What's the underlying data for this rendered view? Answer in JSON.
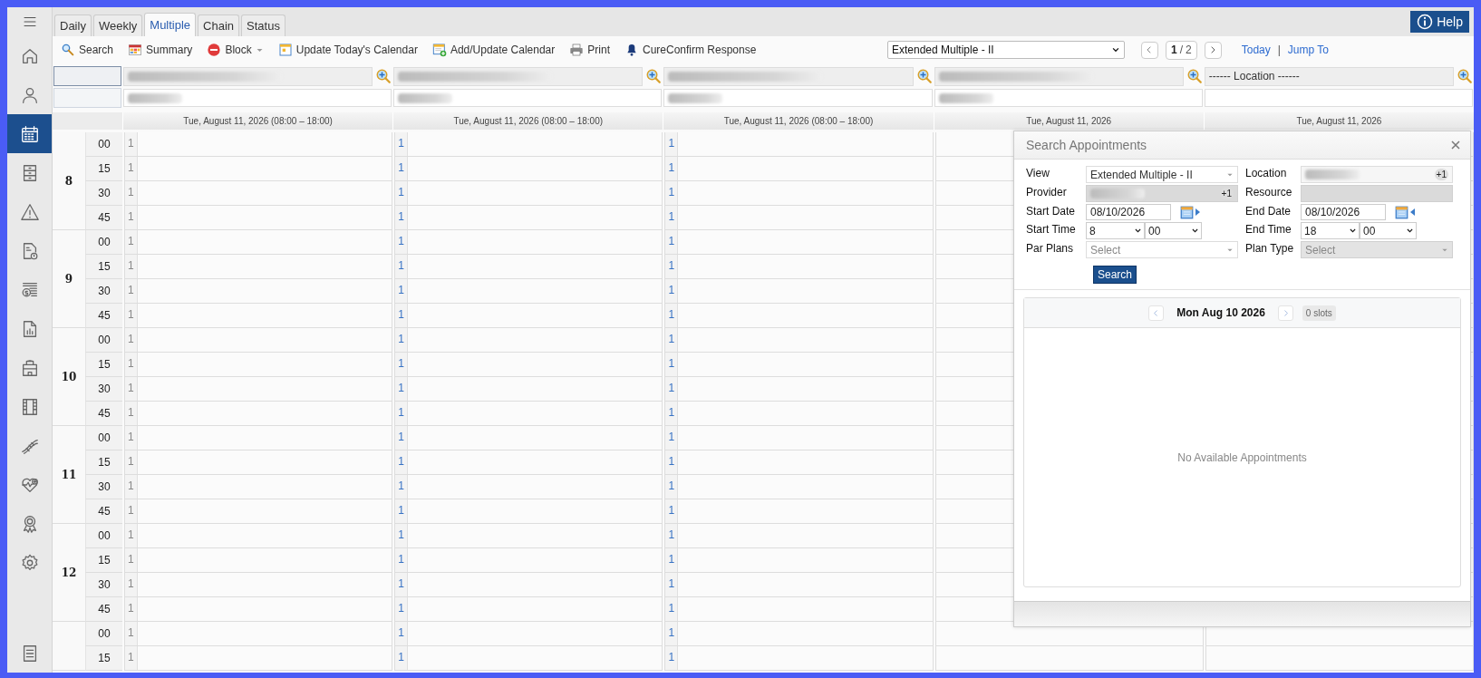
{
  "sidebar": {
    "items": [
      {
        "kind": "home",
        "selected": false
      },
      {
        "kind": "person",
        "selected": false
      },
      {
        "kind": "calendar",
        "selected": true
      },
      {
        "kind": "cabinet",
        "selected": false
      },
      {
        "kind": "warning",
        "selected": false
      },
      {
        "kind": "bill",
        "selected": false
      },
      {
        "kind": "money",
        "selected": false
      },
      {
        "kind": "report",
        "selected": false
      },
      {
        "kind": "building",
        "selected": false
      },
      {
        "kind": "film",
        "selected": false
      },
      {
        "kind": "dna",
        "selected": false
      },
      {
        "kind": "heart",
        "selected": false
      },
      {
        "kind": "award",
        "selected": false
      },
      {
        "kind": "gear",
        "selected": false
      }
    ],
    "bottom": [
      {
        "kind": "list",
        "selected": false
      }
    ]
  },
  "tabs": [
    {
      "label": "Daily",
      "selected": false
    },
    {
      "label": "Weekly",
      "selected": false
    },
    {
      "label": "Multiple",
      "selected": true
    },
    {
      "label": "Chain",
      "selected": false
    },
    {
      "label": "Status",
      "selected": false
    }
  ],
  "help": "Help",
  "toolbar": [
    {
      "kind": "search",
      "label": "Search",
      "dropdown": false
    },
    {
      "kind": "summary",
      "label": "Summary",
      "dropdown": false
    },
    {
      "kind": "block",
      "label": "Block",
      "dropdown": true
    },
    {
      "kind": "today",
      "label": "Update Today's Calendar",
      "dropdown": false
    },
    {
      "kind": "add",
      "label": "Add/Update Calendar",
      "dropdown": false
    },
    {
      "kind": "print",
      "label": "Print",
      "dropdown": false
    },
    {
      "kind": "bell",
      "label": "CureConfirm Response",
      "dropdown": false
    }
  ],
  "view_select": "Extended Multiple - II",
  "pager": {
    "current": "1",
    "separator": "/",
    "total": "2"
  },
  "links": [
    "Today",
    "Jump To"
  ],
  "link_separator": "|",
  "columns": [
    {
      "location_redacted": true,
      "provider_redacted": true,
      "date": "Tue, August 11, 2026 (08:00 – 18:00)",
      "color": "#888888"
    },
    {
      "location_redacted": true,
      "provider_redacted": true,
      "date": "Tue, August 11, 2026 (08:00 – 18:00)",
      "color": "#3772c4"
    },
    {
      "location_redacted": true,
      "provider_redacted": true,
      "date": "Tue, August 11, 2026 (08:00 – 18:00)",
      "color": "#3772c4"
    },
    {
      "location_redacted": true,
      "provider_redacted": true,
      "date": "Tue, August 11, 2026"
    },
    {
      "location": "------ Location ------",
      "provider_redacted": false,
      "date": "Tue, August 11, 2026"
    }
  ],
  "hours": [
    {
      "label": "8",
      "rows": [
        {
          "minute": "00",
          "slots": [
            "1",
            "1",
            "1"
          ]
        },
        {
          "minute": "15",
          "slots": [
            "1",
            "1",
            "1"
          ]
        },
        {
          "minute": "30",
          "slots": [
            "1",
            "1",
            "1"
          ]
        },
        {
          "minute": "45",
          "slots": [
            "1",
            "1",
            "1"
          ]
        }
      ]
    },
    {
      "label": "9",
      "rows": [
        {
          "minute": "00",
          "slots": [
            "1",
            "1",
            "1"
          ]
        },
        {
          "minute": "15",
          "slots": [
            "1",
            "1",
            "1"
          ]
        },
        {
          "minute": "30",
          "slots": [
            "1",
            "1",
            "1"
          ]
        },
        {
          "minute": "45",
          "slots": [
            "1",
            "1",
            "1"
          ]
        }
      ]
    },
    {
      "label": "10",
      "rows": [
        {
          "minute": "00",
          "slots": [
            "1",
            "1",
            "1"
          ]
        },
        {
          "minute": "15",
          "slots": [
            "1",
            "1",
            "1"
          ]
        },
        {
          "minute": "30",
          "slots": [
            "1",
            "1",
            "1"
          ]
        },
        {
          "minute": "45",
          "slots": [
            "1",
            "1",
            "1"
          ]
        }
      ]
    },
    {
      "label": "11",
      "rows": [
        {
          "minute": "00",
          "slots": [
            "1",
            "1",
            "1"
          ]
        },
        {
          "minute": "15",
          "slots": [
            "1",
            "1",
            "1"
          ]
        },
        {
          "minute": "30",
          "slots": [
            "1",
            "1",
            "1"
          ]
        },
        {
          "minute": "45",
          "slots": [
            "1",
            "1",
            "1"
          ]
        }
      ]
    },
    {
      "label": "12",
      "rows": [
        {
          "minute": "00",
          "slots": [
            "1",
            "1",
            "1"
          ]
        },
        {
          "minute": "15",
          "slots": [
            "1",
            "1",
            "1"
          ]
        },
        {
          "minute": "30",
          "slots": [
            "1",
            "1",
            "1"
          ]
        },
        {
          "minute": "45",
          "slots": [
            "1",
            "1",
            "1"
          ]
        }
      ]
    },
    {
      "rows": [
        {
          "minute": "00",
          "slots": [
            "1",
            "1",
            "1"
          ]
        },
        {
          "minute": "15",
          "slots": [
            "1",
            "1",
            "1"
          ]
        }
      ]
    }
  ],
  "dialog": {
    "title": "Search Appointments",
    "fields": [
      {
        "label": "View",
        "kind": "select",
        "value": "Extended Multiple - II",
        "disabled": false
      },
      {
        "label": "Location",
        "kind": "tags",
        "redacted": true,
        "badge": "+1",
        "disabled": false
      },
      {
        "label": "Provider",
        "kind": "tags",
        "redacted": true,
        "badge": "+1",
        "disabled": true
      },
      {
        "label": "Resource",
        "kind": "tags",
        "disabled": true
      },
      {
        "label": "Start Date",
        "kind": "date",
        "value": "08/10/2026",
        "arrow_left": false
      },
      {
        "label": "End Date",
        "kind": "date",
        "value": "08/10/2026",
        "arrow_left": true
      },
      {
        "label": "Start Time",
        "kind": "time",
        "hour": "8",
        "minute": "00"
      },
      {
        "label": "End Time",
        "kind": "time",
        "hour": "18",
        "minute": "00"
      },
      {
        "label": "Par Plans",
        "kind": "select",
        "placeholder": "Select",
        "disabled": false
      },
      {
        "label": "Plan Type",
        "kind": "select",
        "placeholder": "Select",
        "disabled": true
      }
    ],
    "search_button": "Search",
    "day": "Mon Aug 10 2026",
    "slots": "0 slots",
    "empty": "No Available Appointments"
  }
}
